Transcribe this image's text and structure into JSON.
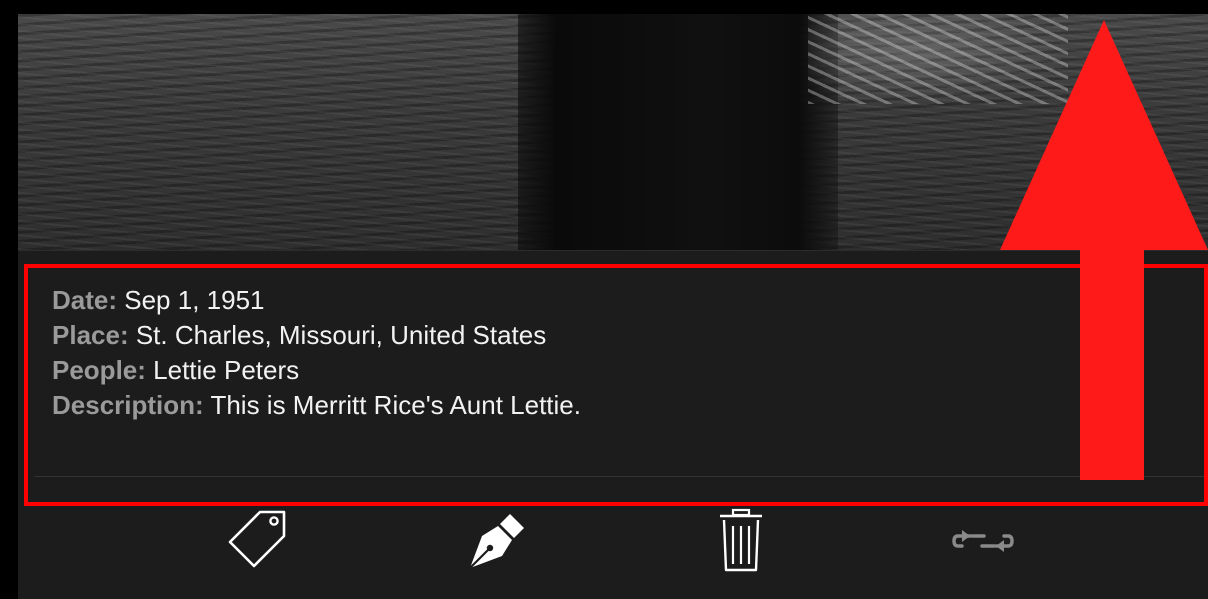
{
  "details": {
    "date_label": "Date:",
    "date_value": "Sep 1, 1951",
    "place_label": "Place:",
    "place_value": "St. Charles, Missouri, United States",
    "people_label": "People:",
    "people_value": "Lettie Peters",
    "description_label": "Description:",
    "description_value": "This is Merritt Rice's Aunt Lettie."
  },
  "toolbar": {
    "icons": [
      "tag-icon",
      "pen-icon",
      "trash-icon",
      "swap-icon"
    ]
  },
  "annotation": {
    "highlight_color": "#ff0000",
    "arrow_color": "#ff1a1a",
    "arrow_direction": "up"
  },
  "colors": {
    "panel_background": "#1c1c1c",
    "label_text": "#9a9a9a",
    "value_text": "#f2f2f2",
    "icon_white": "#ffffff",
    "icon_dim": "#8a8a8a"
  }
}
